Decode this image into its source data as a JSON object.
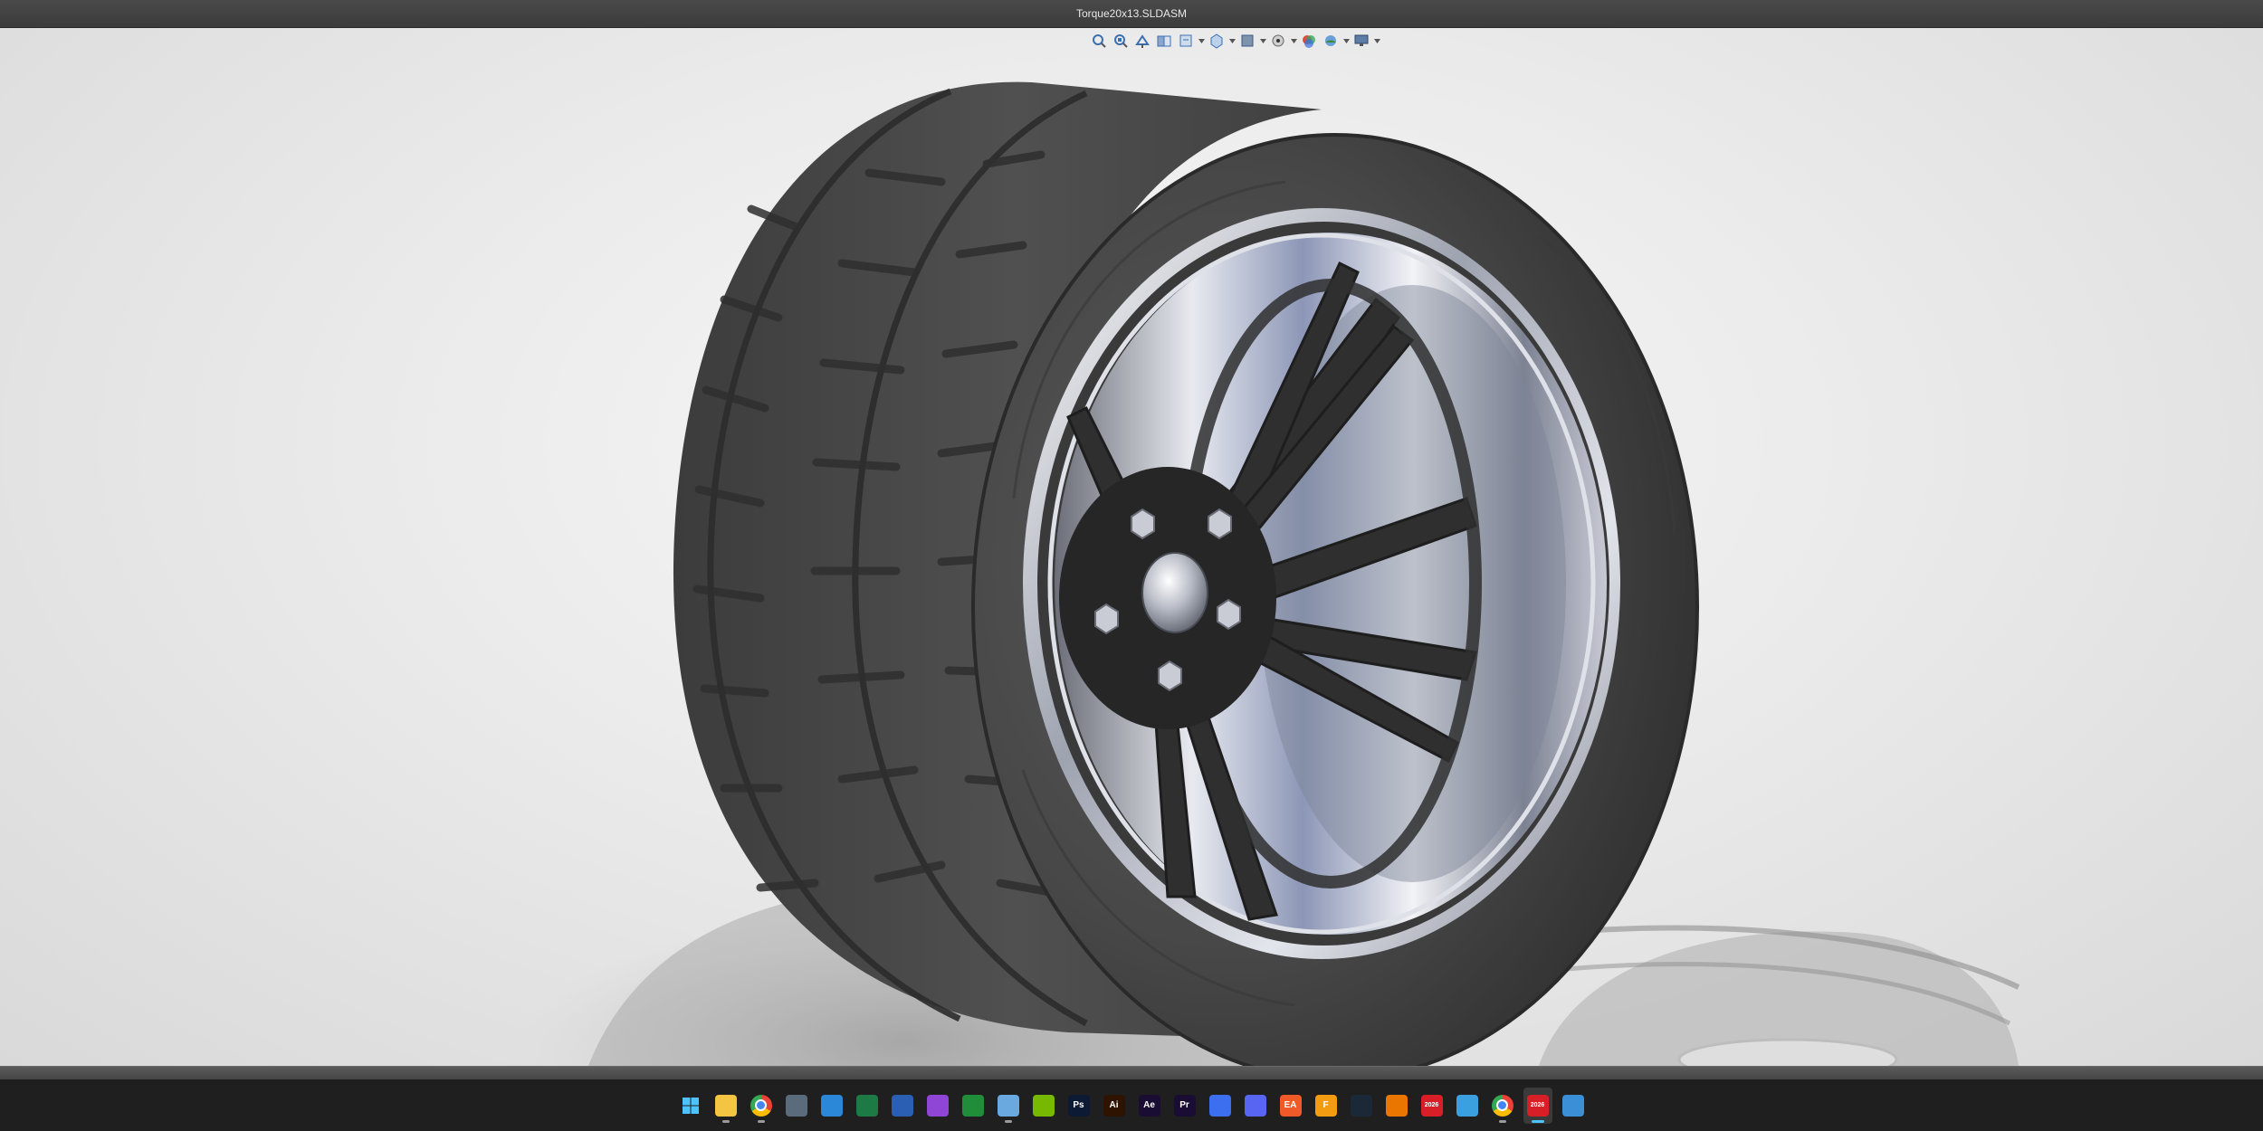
{
  "window": {
    "title": "Torque20x13.SLDASM"
  },
  "hud_toolbar": {
    "items": [
      {
        "icon": "zoom-to-fit-icon",
        "dropdown": false
      },
      {
        "icon": "zoom-to-area-icon",
        "dropdown": false
      },
      {
        "icon": "previous-view-icon",
        "dropdown": false
      },
      {
        "icon": "section-view-icon",
        "dropdown": false
      },
      {
        "icon": "dynamic-annotation-views-icon",
        "dropdown": true
      },
      {
        "icon": "view-orientation-icon",
        "dropdown": true
      },
      {
        "icon": "display-style-icon",
        "dropdown": true
      },
      {
        "icon": "hide-show-items-icon",
        "dropdown": true
      },
      {
        "icon": "edit-appearance-icon",
        "dropdown": false
      },
      {
        "icon": "apply-scene-icon",
        "dropdown": true
      },
      {
        "icon": "view-settings-icon",
        "dropdown": true
      }
    ]
  },
  "taskbar": {
    "items": [
      {
        "name": "windows-start-icon",
        "label": "",
        "color": "#4cc2ff",
        "running": false,
        "active": false
      },
      {
        "name": "file-explorer-icon",
        "label": "",
        "color": "#f4c542",
        "running": true,
        "active": false
      },
      {
        "name": "chrome-icon",
        "label": "",
        "color": "#ea4335",
        "running": true,
        "active": false
      },
      {
        "name": "calculator-icon",
        "label": "",
        "color": "#5a6b7b",
        "running": false,
        "active": false
      },
      {
        "name": "store-icon",
        "label": "",
        "color": "#2b88d8",
        "running": false,
        "active": false
      },
      {
        "name": "excel-icon",
        "label": "",
        "color": "#1d7a45",
        "running": false,
        "active": false
      },
      {
        "name": "word-icon",
        "label": "",
        "color": "#2b5fb4",
        "running": false,
        "active": false
      },
      {
        "name": "screen-capture-icon",
        "label": "",
        "color": "#8f46d6",
        "running": false,
        "active": false
      },
      {
        "name": "xbox-icon",
        "label": "",
        "color": "#1f8d3a",
        "running": false,
        "active": false
      },
      {
        "name": "notepad-icon",
        "label": "",
        "color": "#6aa8e0",
        "running": true,
        "active": false
      },
      {
        "name": "nvidia-icon",
        "label": "",
        "color": "#76b900",
        "running": false,
        "active": false
      },
      {
        "name": "photoshop-icon",
        "label": "Ps",
        "color": "#0d1a33",
        "running": false,
        "active": false
      },
      {
        "name": "illustrator-icon",
        "label": "Ai",
        "color": "#2e1300",
        "running": false,
        "active": false
      },
      {
        "name": "after-effects-icon",
        "label": "Ae",
        "color": "#1a0d33",
        "running": false,
        "active": false
      },
      {
        "name": "premiere-icon",
        "label": "Pr",
        "color": "#1a0d33",
        "running": false,
        "active": false
      },
      {
        "name": "messenger-icon",
        "label": "",
        "color": "#3c6ff0",
        "running": false,
        "active": false
      },
      {
        "name": "discord-icon",
        "label": "",
        "color": "#5865f2",
        "running": false,
        "active": false
      },
      {
        "name": "ea-app-icon",
        "label": "EA",
        "color": "#f05a28",
        "running": false,
        "active": false
      },
      {
        "name": "fusion-icon",
        "label": "F",
        "color": "#f39c12",
        "running": false,
        "active": false
      },
      {
        "name": "steam-icon",
        "label": "",
        "color": "#1b2838",
        "running": false,
        "active": false
      },
      {
        "name": "blender-icon",
        "label": "",
        "color": "#ea7600",
        "running": false,
        "active": false
      },
      {
        "name": "solidworks-2026-icon",
        "label": "2026",
        "color": "#d81e27",
        "running": false,
        "active": false
      },
      {
        "name": "3d-viewer-icon",
        "label": "",
        "color": "#3aa0e0",
        "running": false,
        "active": false
      },
      {
        "name": "chrome-profile-icon",
        "label": "",
        "color": "#ea4335",
        "running": true,
        "active": false
      },
      {
        "name": "solidworks-2026-running-icon",
        "label": "2026",
        "color": "#d81e27",
        "running": true,
        "active": true
      },
      {
        "name": "notes-icon",
        "label": "",
        "color": "#3a8fd6",
        "running": false,
        "active": false
      }
    ]
  },
  "colors": {
    "tire": "#4a4a4a",
    "spokes": "#2e2e2e",
    "chrome": "#c9ccd4",
    "barrel": "#9aa3b8"
  }
}
